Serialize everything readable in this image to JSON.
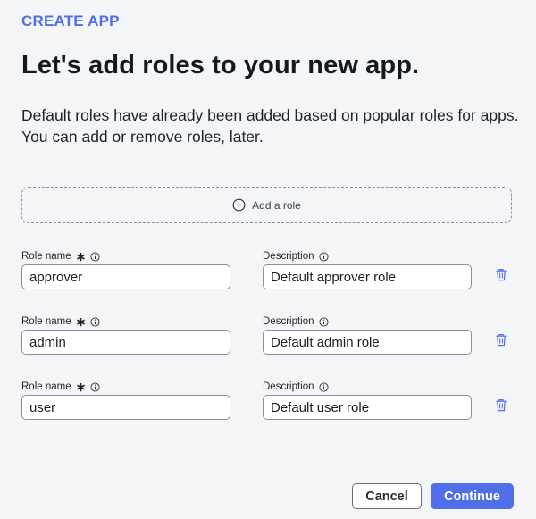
{
  "header": {
    "eyebrow": "CREATE APP",
    "title": "Let's add roles to your new app.",
    "subtitle": "Default roles have already been added based on popular roles for apps. You can add or remove roles, later."
  },
  "add_role": {
    "label": "Add a role",
    "icon": "plus-circle-icon"
  },
  "labels": {
    "role_name": "Role name",
    "required_marker": "∗",
    "description": "Description"
  },
  "roles": [
    {
      "name": "approver",
      "description": "Default approver role"
    },
    {
      "name": "admin",
      "description": "Default admin role"
    },
    {
      "name": "user",
      "description": "Default user role"
    }
  ],
  "footer": {
    "cancel_label": "Cancel",
    "continue_label": "Continue"
  },
  "colors": {
    "accent": "#4f6ee8",
    "background": "#f4f5f7"
  }
}
